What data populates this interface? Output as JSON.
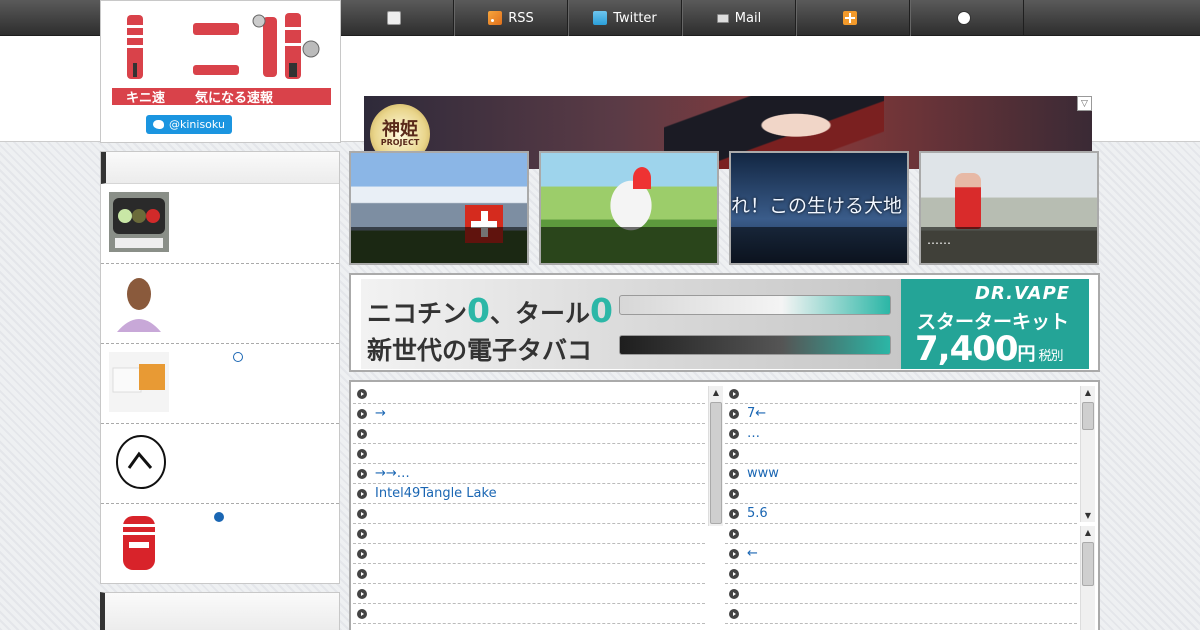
{
  "nav": {
    "items": [
      {
        "label": "",
        "icon": "document-icon"
      },
      {
        "label": "RSS",
        "icon": "rss-icon"
      },
      {
        "label": "Twitter",
        "icon": "twitter-icon"
      },
      {
        "label": "Mail",
        "icon": "mail-icon"
      },
      {
        "label": "",
        "icon": "cross-icon"
      },
      {
        "label": "",
        "icon": "face-icon"
      }
    ]
  },
  "header": {
    "site_name": "キニ速",
    "tagline": "気になる速報",
    "twitter_handle": "@kinisoku"
  },
  "top_banner": {
    "badge_title": "神姫",
    "badge_sub": "PROJECT"
  },
  "sidebar": {
    "items": [
      {
        "label": "",
        "thumb": "traffic-signal"
      },
      {
        "label": "",
        "thumb": "man-thinking"
      },
      {
        "label": "",
        "thumb": "tofu"
      },
      {
        "label": "",
        "thumb": "face-drawing"
      },
      {
        "label": "",
        "thumb": "tenga-cup"
      }
    ]
  },
  "picks": [
    {
      "caption": ""
    },
    {
      "caption": ""
    },
    {
      "caption": "",
      "title": "れ！この生ける大地"
    },
    {
      "caption": "……"
    }
  ],
  "mid_banner": {
    "line1_a": "ニコチン",
    "line1_z1": "0",
    "line1_b": "、タール",
    "line1_z2": "0",
    "line2": "新世代の電子タバコ",
    "brand": "DR.VAPE",
    "kit": "スターターキット",
    "price": "7,400",
    "yen": "円",
    "tax": "税別"
  },
  "feed_left": [
    "",
    "→",
    "",
    "",
    "→→…",
    "Intel49Tangle Lake",
    "",
    "",
    "",
    "",
    "",
    ""
  ],
  "feed_right": [
    "",
    "7←",
    "…",
    "",
    "www",
    "",
    "5.6",
    "",
    "←",
    "",
    "",
    ""
  ],
  "colors": {
    "accent": "#1a66b3",
    "logo_red": "#d9424a",
    "twitter": "#1b95e0",
    "vape_teal": "#24a497"
  }
}
